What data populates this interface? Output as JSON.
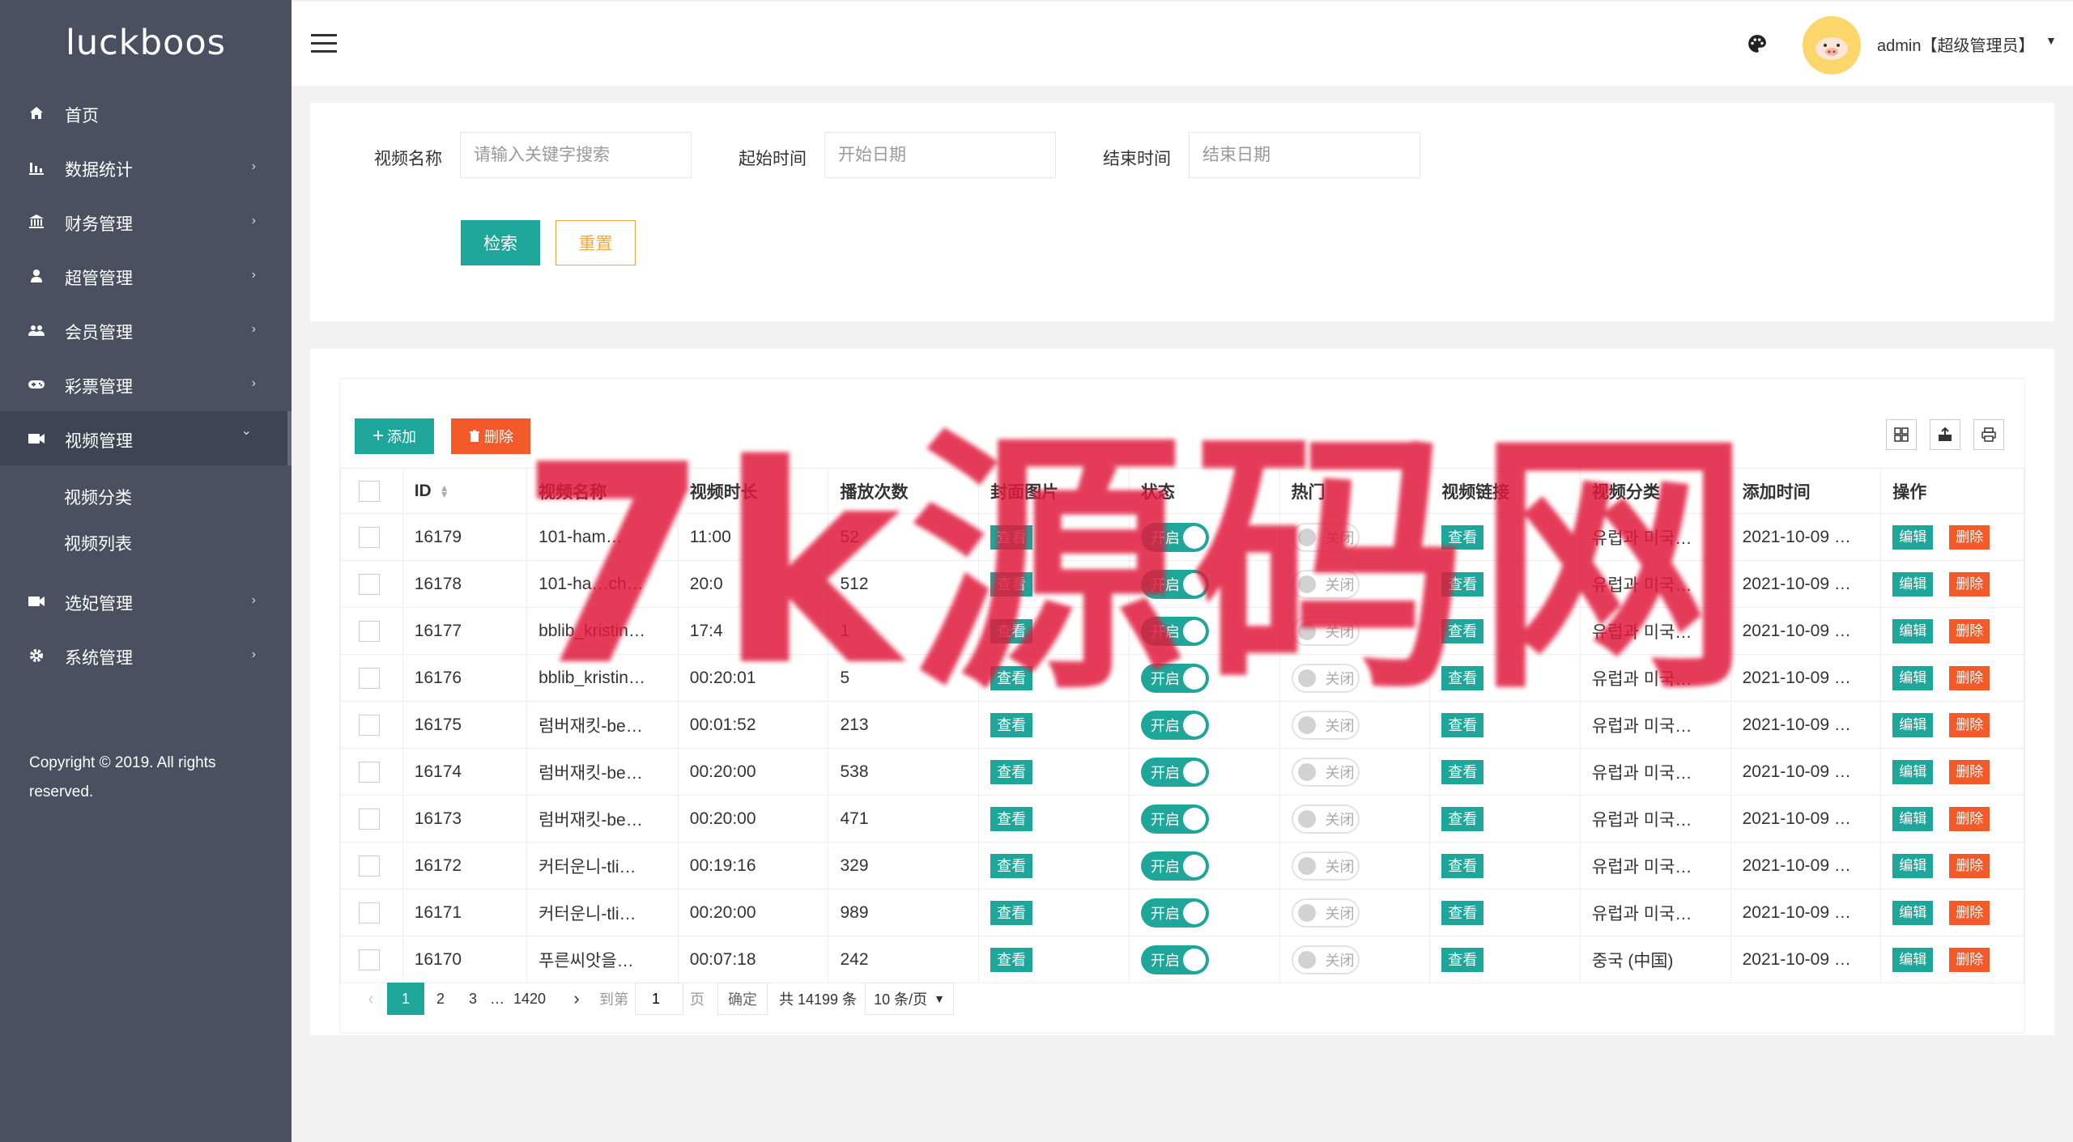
{
  "sidebar": {
    "logo": "luckboos",
    "menu": [
      {
        "label": "首页",
        "icon": "home-icon",
        "has_arrow": false
      },
      {
        "label": "数据统计",
        "icon": "bar-chart-icon",
        "has_arrow": true
      },
      {
        "label": "财务管理",
        "icon": "bank-icon",
        "has_arrow": true
      },
      {
        "label": "超管管理",
        "icon": "user-icon",
        "has_arrow": true
      },
      {
        "label": "会员管理",
        "icon": "users-icon",
        "has_arrow": true
      },
      {
        "label": "彩票管理",
        "icon": "gamepad-icon",
        "has_arrow": true
      },
      {
        "label": "视频管理",
        "icon": "video-icon",
        "has_arrow": true,
        "expanded": true
      },
      {
        "label": "选妃管理",
        "icon": "video-icon",
        "has_arrow": true
      },
      {
        "label": "系统管理",
        "icon": "gear-icon",
        "has_arrow": true
      }
    ],
    "submenu": [
      "视频分类",
      "视频列表"
    ],
    "copyright": "Copyright © 2019. All rights reserved."
  },
  "header": {
    "admin_name": "admin【超级管理员】"
  },
  "search": {
    "name_label": "视频名称",
    "name_placeholder": "请输入关键字搜索",
    "start_label": "起始时间",
    "start_placeholder": "开始日期",
    "end_label": "结束时间",
    "end_placeholder": "结束日期",
    "search_button": "检索",
    "reset_button": "重置"
  },
  "toolbar": {
    "add_label": "添加",
    "delete_label": "删除"
  },
  "table": {
    "headers": [
      "ID",
      "视频名称",
      "视频时长",
      "播放次数",
      "封面图片",
      "状态",
      "热门",
      "视频链接",
      "视频分类",
      "添加时间",
      "操作"
    ],
    "view_label": "查看",
    "on_label": "开启",
    "off_label": "关闭",
    "edit_label": "编辑",
    "del_label": "删除",
    "rows": [
      {
        "id": "16179",
        "name": "101-ham…",
        "duration": "11:00",
        "plays": "52",
        "category": "유럽과 미국…",
        "time": "2021-10-09 …"
      },
      {
        "id": "16178",
        "name": "101-ha…ch…",
        "duration": "20:0",
        "plays": "512",
        "category": "유럽과 미국…",
        "time": "2021-10-09 …"
      },
      {
        "id": "16177",
        "name": "bblib_kristin…",
        "duration": "17:4",
        "plays": "1",
        "category": "유럽과 미국…",
        "time": "2021-10-09 …"
      },
      {
        "id": "16176",
        "name": "bblib_kristin…",
        "duration": "00:20:01",
        "plays": "5",
        "category": "유럽과 미국…",
        "time": "2021-10-09 …"
      },
      {
        "id": "16175",
        "name": "럼버재킷-be…",
        "duration": "00:01:52",
        "plays": "213",
        "category": "유럽과 미국…",
        "time": "2021-10-09 …"
      },
      {
        "id": "16174",
        "name": "럼버재킷-be…",
        "duration": "00:20:00",
        "plays": "538",
        "category": "유럽과 미국…",
        "time": "2021-10-09 …"
      },
      {
        "id": "16173",
        "name": "럼버재킷-be…",
        "duration": "00:20:00",
        "plays": "471",
        "category": "유럽과 미국…",
        "time": "2021-10-09 …"
      },
      {
        "id": "16172",
        "name": "커터운니-tli…",
        "duration": "00:19:16",
        "plays": "329",
        "category": "유럽과 미국…",
        "time": "2021-10-09 …"
      },
      {
        "id": "16171",
        "name": "커터운니-tli…",
        "duration": "00:20:00",
        "plays": "989",
        "category": "유럽과 미국…",
        "time": "2021-10-09 …"
      },
      {
        "id": "16170",
        "name": "푸른씨앗을…",
        "duration": "00:07:18",
        "plays": "242",
        "category": "중국 (中国)",
        "time": "2021-10-09 …"
      }
    ]
  },
  "pagination": {
    "pages": [
      "1",
      "2",
      "3"
    ],
    "ellipsis": "…",
    "last_page": "1420",
    "goto_label": "到第",
    "goto_value": "1",
    "page_unit": "页",
    "confirm_label": "确定",
    "total_label": "共 14199 条",
    "page_size_label": "10 条/页"
  },
  "watermark": "7k源码网",
  "colors": {
    "sidebar_bg": "#4a5060",
    "accent": "#1ea69a",
    "danger": "#f35a2a",
    "warning": "#f0a83e"
  }
}
